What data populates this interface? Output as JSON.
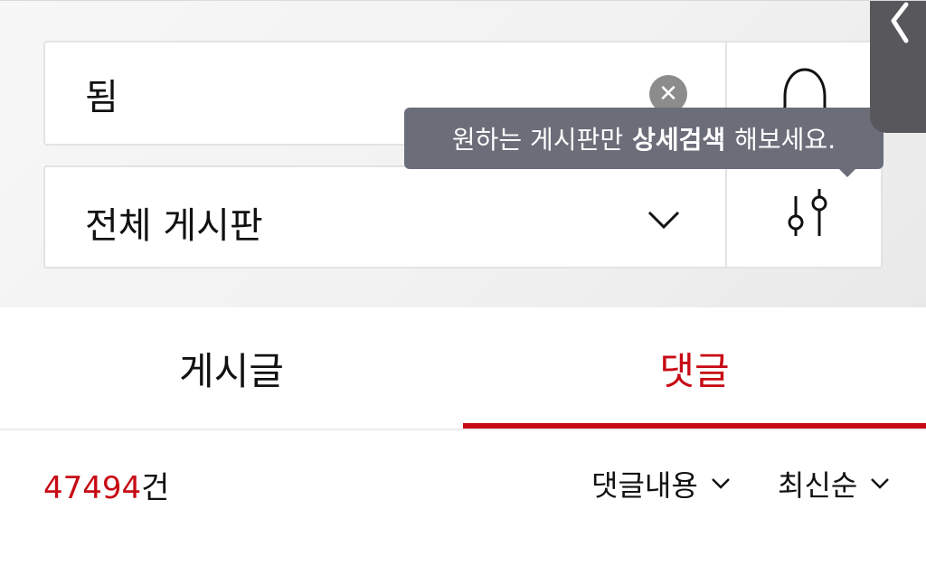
{
  "search": {
    "query": "됨"
  },
  "board": {
    "selected": "전체 게시판"
  },
  "tooltip": {
    "prefix": "원하는 게시판만",
    "bold": "상세검색",
    "suffix": "해보세요."
  },
  "tabs": [
    {
      "label": "게시글",
      "active": false
    },
    {
      "label": "댓글",
      "active": true
    }
  ],
  "results": {
    "count": "47494",
    "unit": "건"
  },
  "filters": {
    "type_label": "댓글내용",
    "sort_label": "최신순"
  },
  "colors": {
    "accent": "#c70a14",
    "tooltip_bg": "#6b6d79",
    "clear_btn": "#8c8c8c"
  },
  "icons": [
    "clear-icon",
    "bell-icon",
    "chevron-down-icon",
    "filter-sliders-icon",
    "back-arrow-icon"
  ]
}
